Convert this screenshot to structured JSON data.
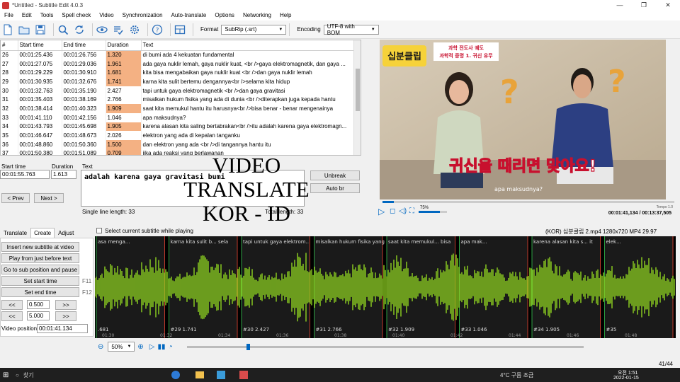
{
  "window": {
    "title": "*Untitled - Subtitle Edit 4.0.3"
  },
  "menu": [
    "File",
    "Edit",
    "Tools",
    "Spell check",
    "Video",
    "Synchronization",
    "Auto-translate",
    "Options",
    "Networking",
    "Help"
  ],
  "toolbar": {
    "format_label": "Format",
    "format_value": "SubRip (.srt)",
    "encoding_label": "Encoding",
    "encoding_value": "UTF-8 with BOM"
  },
  "grid": {
    "headers": [
      "#",
      "Start time",
      "End time",
      "Duration",
      "Text"
    ],
    "rows": [
      {
        "n": "26",
        "start": "00:01:25.436",
        "end": "00:01:26.756",
        "dur": "1.320",
        "warn": true,
        "text": "di bumi ada 4 kekuatan fundamental"
      },
      {
        "n": "27",
        "start": "00:01:27.075",
        "end": "00:01:29.036",
        "dur": "1.961",
        "warn": true,
        "text": "ada gaya nuklir lemah, gaya nuklir kuat, <br />gaya elektromagnetik, dan gaya ..."
      },
      {
        "n": "28",
        "start": "00:01:29.229",
        "end": "00:01:30.910",
        "dur": "1.681",
        "warn": true,
        "text": "kita bisa mengabaikan gaya nuklir kuat <br />dan gaya nuklir lemah"
      },
      {
        "n": "29",
        "start": "00:01:30.935",
        "end": "00:01:32.676",
        "dur": "1.741",
        "warn": true,
        "text": "karna kita sulit bertemu dengannya<br />selama kita hidup"
      },
      {
        "n": "30",
        "start": "00:01:32.763",
        "end": "00:01:35.190",
        "dur": "2.427",
        "warn": false,
        "text": "tapi untuk gaya elektromagnetik <br />dan gaya gravitasi"
      },
      {
        "n": "31",
        "start": "00:01:35.403",
        "end": "00:01:38.169",
        "dur": "2.766",
        "warn": false,
        "text": "misalkan hukum fisika yang ada di dunia <br />diterapkan juga kepada hantu"
      },
      {
        "n": "32",
        "start": "00:01:38.414",
        "end": "00:01:40.323",
        "dur": "1.909",
        "warn": true,
        "text": "saat kita memukul hantu itu harusnya<br />bisa benar - benar mengenainya"
      },
      {
        "n": "33",
        "start": "00:01:41.110",
        "end": "00:01:42.156",
        "dur": "1.046",
        "warn": false,
        "text": "apa maksudnya?"
      },
      {
        "n": "34",
        "start": "00:01:43.793",
        "end": "00:01:45.698",
        "dur": "1.905",
        "warn": true,
        "text": "karena alasan kita saling bertabrakan<br />itu adalah karena gaya elektromagn..."
      },
      {
        "n": "35",
        "start": "00:01:46.647",
        "end": "00:01:48.673",
        "dur": "2.026",
        "warn": false,
        "text": "elektron yang ada di kepalan tanganku"
      },
      {
        "n": "36",
        "start": "00:01:48.860",
        "end": "00:01:50.360",
        "dur": "1.500",
        "warn": true,
        "text": "dan elektron yang ada <br />di tangannya hantu itu"
      },
      {
        "n": "37",
        "start": "00:01:50.380",
        "end": "00:01:51.089",
        "dur": "0.709",
        "warn": true,
        "text": "jika ada reaksi yang berlawanan"
      }
    ]
  },
  "edit": {
    "start_label": "Start time",
    "duration_label": "Duration",
    "text_label": "Text",
    "start_value": "00:01:55.763",
    "duration_value": "1.613",
    "text_value": "adalah karena gaya gravitasi bumi",
    "prev": "< Prev",
    "next": "Next >",
    "unbreak": "Unbreak",
    "autobr": "Auto br",
    "single_line": "Single line length: 33",
    "total_length": "Total length: 33"
  },
  "overlay": {
    "line1": "VIDEO TRANSLATE",
    "line2": "KOR - ID"
  },
  "video": {
    "badge_line1": "과학 전도사 궤도",
    "badge_line2": "과학적 증명 1. 귀신 유무",
    "logo": "십분클립",
    "caption": "귀신을 때리면 맞아요!",
    "subtitle": "apa maksudnya?",
    "volume": "75%",
    "tempo": "Tempo 1.0",
    "time": "00:01:41,134 / 00:13:37,505"
  },
  "bottom": {
    "tabs": [
      "Translate",
      "Create",
      "Adjust"
    ],
    "active_tab": "Create",
    "buttons": [
      "Insert new subtitle at video",
      "Play from just before text",
      "Go to sub position and pause",
      "Set start time",
      "Set end time"
    ],
    "f11": "F11",
    "f12": "F12",
    "step1": "0.500",
    "step2": "5.000",
    "video_pos_label": "Video position:",
    "video_pos": "00:01:41.134",
    "checkbox_label": "Select current subtitle while playing",
    "media_info": "(KOR) 십분클립 2.mp4 1280x720 MP4 29.97",
    "zoom": "50%",
    "counter": "41/44"
  },
  "waveform": {
    "segments": [
      {
        "text": "asa menga...",
        "label": ".681"
      },
      {
        "text": "karna kita sulit b... selama kita hidup",
        "label": "#29  1.741"
      },
      {
        "text": "tapi untuk gaya elektrom... dan gaya gravitasi",
        "label": "#30  2.427"
      },
      {
        "text": "misalkan hukum fisika yang a... diterapkan juga kepada hantu",
        "label": "#31  2.766"
      },
      {
        "text": "saat kita memukul... bisa benar - benar ...",
        "label": "#32  1.909"
      },
      {
        "text": "apa mak...",
        "label": "#33  1.046"
      },
      {
        "text": "karena alasan kita s... itu adalah karena g...",
        "label": "#34  1.905"
      },
      {
        "text": "elek...",
        "label": "#35"
      }
    ],
    "times": [
      "01:30",
      "01:32",
      "01:34",
      "01:36",
      "01:38",
      "01:40",
      "01:42",
      "01:44",
      "01:46",
      "01:48"
    ]
  },
  "taskbar": {
    "search": "찾기",
    "weather": "4°C 구름 조금",
    "time": "오전 1:51",
    "date": "2022-01-15"
  },
  "colors": {
    "accent": "#0067c0",
    "warn": "#f4b183",
    "wave": "#8fd420"
  }
}
